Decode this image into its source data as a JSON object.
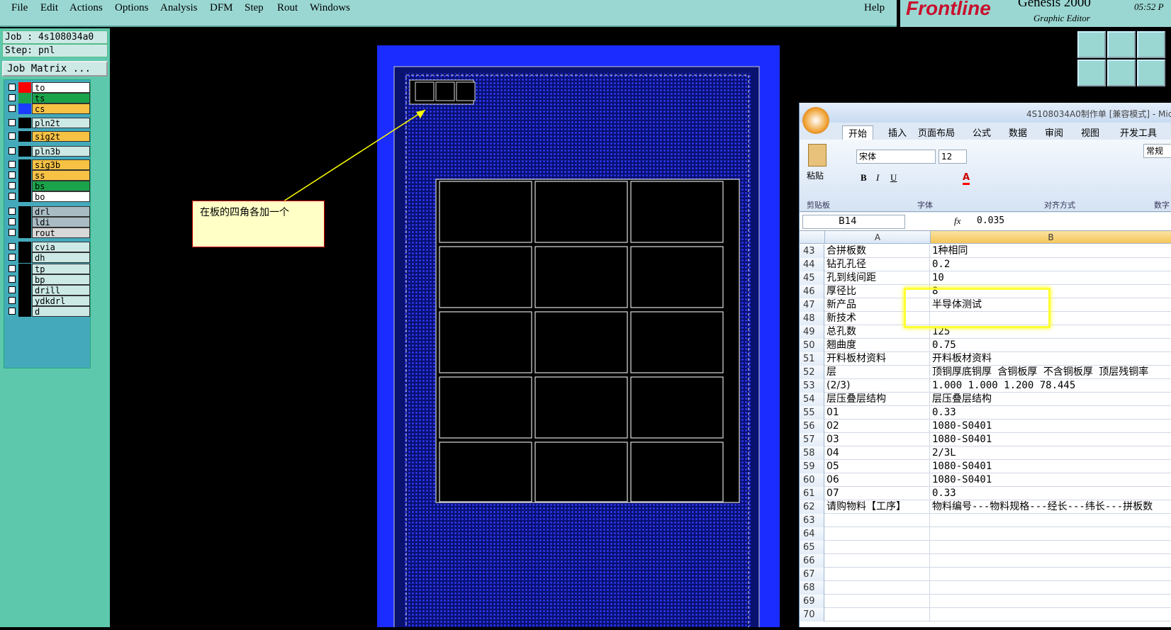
{
  "menu": [
    "File",
    "Edit",
    "Actions",
    "Options",
    "Analysis",
    "DFM",
    "Step",
    "Rout",
    "Windows"
  ],
  "help": "Help",
  "logo": {
    "brand": "Frontline",
    "product": "Genesis 2000",
    "subtitle": "Graphic Editor",
    "time": "05:52 P"
  },
  "job": "Job : 4s108034a0",
  "step": "Step: pnl",
  "job_matrix": "Job Matrix ...",
  "layers": [
    {
      "name": "to",
      "color": "#ff0000",
      "bg": "#ffffff"
    },
    {
      "name": "ts",
      "color": "#1aa34a",
      "bg": "#1aa34a"
    },
    {
      "name": "cs",
      "color": "#1a3cff",
      "bg": "#f7c244"
    },
    {
      "name": "pln2t",
      "color": "#000000",
      "bg": "#cce9e6"
    },
    {
      "name": "sig2t",
      "color": "#000000",
      "bg": "#f7c244"
    },
    {
      "name": "pln3b",
      "color": "#000000",
      "bg": "#cce9e6"
    },
    {
      "name": "sig3b",
      "color": "#000000",
      "bg": "#f7c244"
    },
    {
      "name": "ss",
      "color": "#000000",
      "bg": "#f7c244"
    },
    {
      "name": "bs",
      "color": "#000000",
      "bg": "#1aa34a"
    },
    {
      "name": "bo",
      "color": "#000000",
      "bg": "#ffffff"
    },
    {
      "name": "drl",
      "color": "#000000",
      "bg": "#a9bcc4"
    },
    {
      "name": "ldi",
      "color": "#000000",
      "bg": "#a9bcc4"
    },
    {
      "name": "rout",
      "color": "#000000",
      "bg": "#d8d8d8"
    },
    {
      "name": "cvia",
      "color": "#000000",
      "bg": "#cce9e6"
    },
    {
      "name": "dh",
      "color": "#000000",
      "bg": "#cce9e6"
    },
    {
      "name": "tp",
      "color": "#000000",
      "bg": "#cce9e6"
    },
    {
      "name": "bp",
      "color": "#000000",
      "bg": "#cce9e6"
    },
    {
      "name": "drill",
      "color": "#000000",
      "bg": "#cce9e6"
    },
    {
      "name": "ydkdrl",
      "color": "#000000",
      "bg": "#cce9e6"
    },
    {
      "name": "d",
      "color": "#000000",
      "bg": "#cce9e6"
    }
  ],
  "note": "在板的四角各加一个",
  "excel": {
    "title": "4S108034A0制作单 [兼容模式] - Mic",
    "tabs": [
      "开始",
      "插入",
      "页面布局",
      "公式",
      "数据",
      "审阅",
      "视图",
      "开发工具"
    ],
    "paste": "粘贴",
    "font_name": "宋体",
    "font_size": "12",
    "number_format": "常规",
    "groups": [
      "剪贴板",
      "字体",
      "对齐方式",
      "数字"
    ],
    "name_box": "B14",
    "fx": "fx",
    "formula": "0.035",
    "col_a": "A",
    "col_b": "B",
    "rows": [
      [
        "43",
        "合拼板数",
        "1种相同"
      ],
      [
        "44",
        "钻孔孔径",
        "0.2"
      ],
      [
        "45",
        "孔到线间距",
        "10"
      ],
      [
        "46",
        "厚径比",
        "8"
      ],
      [
        "47",
        "新产品",
        "半导体测试"
      ],
      [
        "48",
        "新技术",
        ""
      ],
      [
        "49",
        "总孔数",
        "125"
      ],
      [
        "50",
        "翘曲度",
        "0.75"
      ],
      [
        "51",
        "开料板材资料",
        "开料板材资料"
      ],
      [
        "52",
        "层",
        "顶铜厚底铜厚 含铜板厚 不含铜板厚 顶层残铜率"
      ],
      [
        "53",
        "(2/3)",
        "1.000  1.000   1.200            78.445"
      ],
      [
        "54",
        "层压叠层结构",
        "层压叠层结构"
      ],
      [
        "55",
        "01",
        "0.33"
      ],
      [
        "56",
        "02",
        "1080-S0401"
      ],
      [
        "57",
        "03",
        "1080-S0401"
      ],
      [
        "58",
        "04",
        "2/3L"
      ],
      [
        "59",
        "05",
        "1080-S0401"
      ],
      [
        "60",
        "06",
        "1080-S0401"
      ],
      [
        "61",
        "07",
        "0.33"
      ],
      [
        "62",
        "请购物料【工序】",
        "物料编号---物料规格---经长---纬长---拼板数"
      ],
      [
        "63",
        "",
        ""
      ],
      [
        "64",
        "",
        ""
      ],
      [
        "65",
        "",
        ""
      ],
      [
        "66",
        "",
        ""
      ],
      [
        "67",
        "",
        ""
      ],
      [
        "68",
        "",
        ""
      ],
      [
        "69",
        "",
        ""
      ],
      [
        "70",
        "",
        ""
      ]
    ]
  }
}
